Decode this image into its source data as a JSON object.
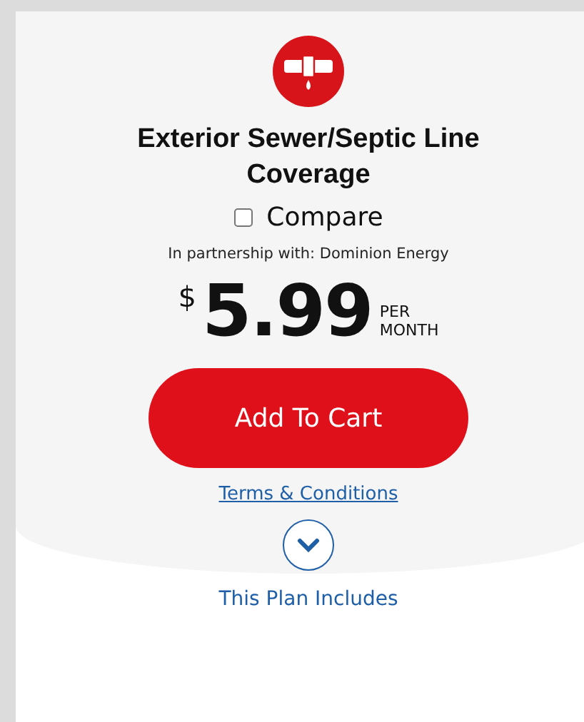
{
  "plan": {
    "title": "Exterior Sewer/Septic Line Coverage",
    "compare": {
      "label": "Compare",
      "checked": false
    },
    "partnership": "In partnership with: Dominion Energy",
    "price": {
      "currency": "$",
      "amount": "5.99",
      "per": "PER",
      "period": "MONTH"
    },
    "add_button": "Add To Cart",
    "terms_link": "Terms & Conditions",
    "includes": {
      "label": "This Plan Includes",
      "expanded": false
    }
  }
}
